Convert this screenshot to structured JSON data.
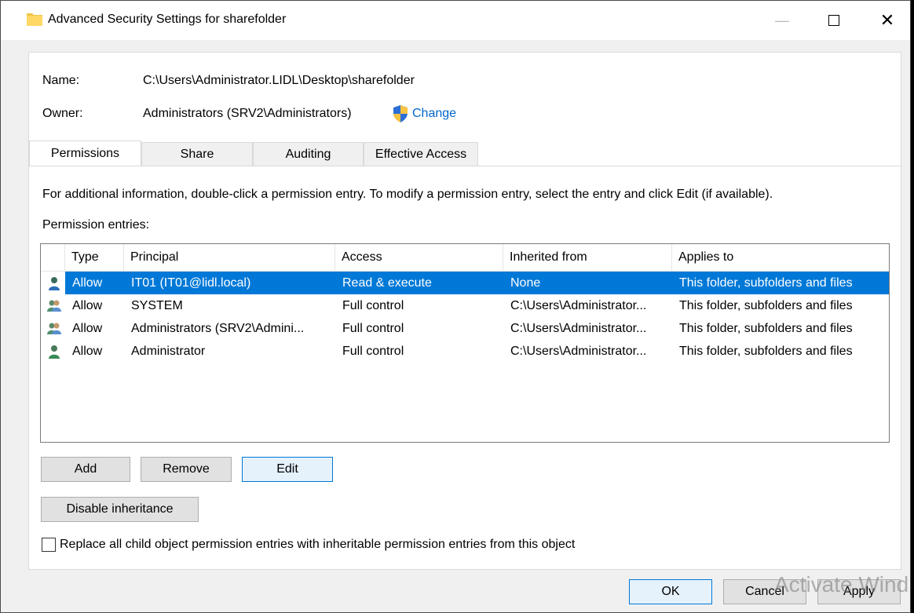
{
  "window": {
    "title": "Advanced Security Settings for sharefolder",
    "controls": {
      "minimize": "—",
      "close": "✕"
    }
  },
  "info": {
    "name_label": "Name:",
    "name_value": "C:\\Users\\Administrator.LIDL\\Desktop\\sharefolder",
    "owner_label": "Owner:",
    "owner_value": "Administrators (SRV2\\Administrators)",
    "change_link": "Change"
  },
  "tabs": [
    {
      "label": "Permissions",
      "active": true
    },
    {
      "label": "Share",
      "active": false
    },
    {
      "label": "Auditing",
      "active": false
    },
    {
      "label": "Effective Access",
      "active": false
    }
  ],
  "instructions": "For additional information, double-click a permission entry. To modify a permission entry, select the entry and click Edit (if available).",
  "entries_label": "Permission entries:",
  "table": {
    "columns": [
      "Type",
      "Principal",
      "Access",
      "Inherited from",
      "Applies to"
    ],
    "rows": [
      {
        "icon": "user-icon",
        "type": "Allow",
        "principal": "IT01 (IT01@lidl.local)",
        "access": "Read & execute",
        "inherited": "None",
        "applies": "This folder, subfolders and files",
        "selected": true
      },
      {
        "icon": "group-icon",
        "type": "Allow",
        "principal": "SYSTEM",
        "access": "Full control",
        "inherited": "C:\\Users\\Administrator...",
        "applies": "This folder, subfolders and files",
        "selected": false
      },
      {
        "icon": "group-icon",
        "type": "Allow",
        "principal": "Administrators (SRV2\\Admini...",
        "access": "Full control",
        "inherited": "C:\\Users\\Administrator...",
        "applies": "This folder, subfolders and files",
        "selected": false
      },
      {
        "icon": "user-icon",
        "type": "Allow",
        "principal": "Administrator",
        "access": "Full control",
        "inherited": "C:\\Users\\Administrator...",
        "applies": "This folder, subfolders and files",
        "selected": false
      }
    ]
  },
  "buttons": {
    "add": "Add",
    "remove": "Remove",
    "edit": "Edit",
    "disable_inheritance": "Disable inheritance",
    "ok": "OK",
    "cancel": "Cancel",
    "apply": "Apply"
  },
  "replace_checkbox": {
    "label": "Replace all child object permission entries with inheritable permission entries from this object",
    "checked": false
  },
  "watermark": "Activate Wind"
}
